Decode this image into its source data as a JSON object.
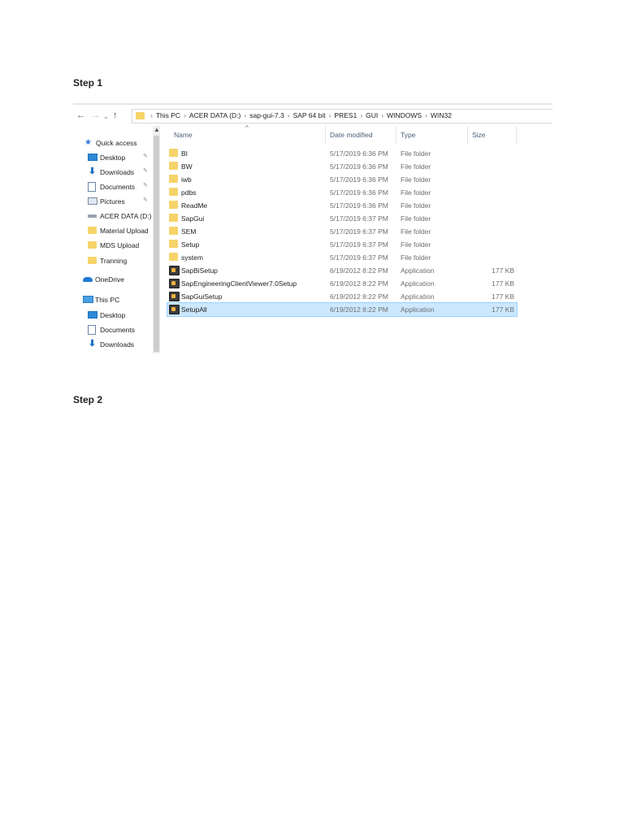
{
  "steps": {
    "step1": "Step 1",
    "step2": "Step 2"
  },
  "nav": {
    "back_icon": "arrow-left",
    "forward_icon": "arrow-right",
    "recent_icon": "chevron-down",
    "up_icon": "arrow-up"
  },
  "address": {
    "crumbs": [
      "This PC",
      "ACER DATA (D:)",
      "sap-gui-7.3",
      "SAP 64 bit",
      "PRES1",
      "GUI",
      "WINDOWS",
      "WIN32"
    ]
  },
  "sidebar": {
    "items": [
      {
        "label": "Quick access",
        "icon": "star"
      },
      {
        "label": "Desktop",
        "icon": "desktop"
      },
      {
        "label": "Downloads",
        "icon": "download-arrow"
      },
      {
        "label": "Documents",
        "icon": "document"
      },
      {
        "label": "Pictures",
        "icon": "pictures"
      },
      {
        "label": "ACER DATA (D:)",
        "icon": "drive"
      },
      {
        "label": "Material Upload",
        "icon": "folder"
      },
      {
        "label": "MDS Upload",
        "icon": "folder"
      },
      {
        "label": "Tranning",
        "icon": "folder"
      },
      {
        "label": "OneDrive",
        "icon": "cloud"
      },
      {
        "label": "This PC",
        "icon": "computer"
      },
      {
        "label": "Desktop",
        "icon": "desktop"
      },
      {
        "label": "Documents",
        "icon": "document"
      },
      {
        "label": "Downloads",
        "icon": "download-arrow"
      }
    ]
  },
  "columns": {
    "name": "Name",
    "date": "Date modified",
    "type": "Type",
    "size": "Size"
  },
  "files": [
    {
      "name": "BI",
      "date": "5/17/2019 6:36 PM",
      "type": "File folder",
      "size": "",
      "kind": "folder"
    },
    {
      "name": "BW",
      "date": "5/17/2019 6:36 PM",
      "type": "File folder",
      "size": "",
      "kind": "folder"
    },
    {
      "name": "iwb",
      "date": "5/17/2019 6:36 PM",
      "type": "File folder",
      "size": "",
      "kind": "folder"
    },
    {
      "name": "pdbs",
      "date": "5/17/2019 6:36 PM",
      "type": "File folder",
      "size": "",
      "kind": "folder"
    },
    {
      "name": "ReadMe",
      "date": "5/17/2019 6:36 PM",
      "type": "File folder",
      "size": "",
      "kind": "folder"
    },
    {
      "name": "SapGui",
      "date": "5/17/2019 6:37 PM",
      "type": "File folder",
      "size": "",
      "kind": "folder"
    },
    {
      "name": "SEM",
      "date": "5/17/2019 6:37 PM",
      "type": "File folder",
      "size": "",
      "kind": "folder"
    },
    {
      "name": "Setup",
      "date": "5/17/2019 6:37 PM",
      "type": "File folder",
      "size": "",
      "kind": "folder"
    },
    {
      "name": "system",
      "date": "5/17/2019 6:37 PM",
      "type": "File folder",
      "size": "",
      "kind": "folder"
    },
    {
      "name": "SapBiSetup",
      "date": "6/19/2012 8:22 PM",
      "type": "Application",
      "size": "177 KB",
      "kind": "app"
    },
    {
      "name": "SapEngineeringClientViewer7.0Setup",
      "date": "6/19/2012 8:22 PM",
      "type": "Application",
      "size": "177 KB",
      "kind": "app"
    },
    {
      "name": "SapGuiSetup",
      "date": "6/19/2012 8:22 PM",
      "type": "Application",
      "size": "177 KB",
      "kind": "app"
    },
    {
      "name": "SetupAll",
      "date": "6/19/2012 8:22 PM",
      "type": "Application",
      "size": "177 KB",
      "kind": "app",
      "selected": true
    }
  ]
}
